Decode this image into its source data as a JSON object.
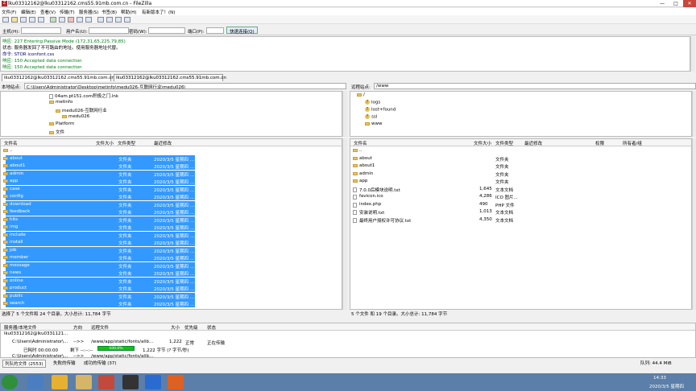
{
  "window": {
    "title": "lku03312162@lku03312162.cms55.91mb.com.cn - FileZilla",
    "minimize": "—",
    "maximize": "□",
    "close": "✕"
  },
  "menu": [
    "文件(F)",
    "编辑(E)",
    "查看(V)",
    "传输(T)",
    "服务器(S)",
    "书签(B)",
    "帮助(H)",
    "有新版本了！(N)"
  ],
  "quickconnect": {
    "host_label": "主机(H):",
    "user_label": "用户名(U):",
    "pass_label": "密码(W):",
    "port_label": "端口(P):",
    "button": "快速连接(Q)"
  },
  "log": [
    {
      "prefix": "响应:",
      "text": "227 Entering Passive Mode (172,31,65,225,79,85)",
      "color": "green"
    },
    {
      "prefix": "状态:",
      "text": "服务器发回了不可路由的地址。使用服务器地址代替。",
      "color": "black"
    },
    {
      "prefix": "命令:",
      "text": "STOR iconfont.css",
      "color": "navy"
    },
    {
      "prefix": "响应:",
      "text": "150 Accepted data connection",
      "color": "green"
    },
    {
      "prefix": "响应:",
      "text": "150 Accepted data connection",
      "color": "green"
    }
  ],
  "tabs": [
    "lku03312162@lku03312162.cms55.91mb.com.cn",
    "lku03312162@lku03312162.cms55.91mb.com.cn"
  ],
  "local": {
    "path_label": "本地站点:",
    "path": "C:\\Users\\Administrator\\Desktop\\metinfo\\medu026-互联网行业\\medu026\\",
    "tree": [
      {
        "label": "04am.pt151.com积极之门.lnk",
        "type": "file",
        "indent": 3
      },
      {
        "label": "metinfo",
        "type": "folder",
        "indent": 3
      },
      {
        "label": "medu026-互联网行业",
        "type": "folder",
        "indent": 4
      },
      {
        "label": "medu026",
        "type": "folder",
        "indent": 5
      },
      {
        "label": "Platform",
        "type": "folder",
        "indent": 3
      },
      {
        "label": "文件",
        "type": "folder",
        "indent": 3
      }
    ],
    "columns": [
      "文件名",
      "文件大小",
      "文件类型",
      "最近修改"
    ],
    "files": [
      {
        "name": "..",
        "type": "",
        "date": "",
        "sel": false
      },
      {
        "name": "about",
        "type": "文件夹",
        "date": "2020/3/5 星期四 ...",
        "sel": true
      },
      {
        "name": "about1",
        "type": "文件夹",
        "date": "2020/3/5 星期四 ...",
        "sel": true
      },
      {
        "name": "admin",
        "type": "文件夹",
        "date": "2020/3/5 星期四 ...",
        "sel": true
      },
      {
        "name": "app",
        "type": "文件夹",
        "date": "2020/3/5 星期四 ...",
        "sel": true
      },
      {
        "name": "case",
        "type": "文件夹",
        "date": "2020/3/5 星期四 ...",
        "sel": true
      },
      {
        "name": "config",
        "type": "文件夹",
        "date": "2020/3/5 星期四 ...",
        "sel": true
      },
      {
        "name": "download",
        "type": "文件夹",
        "date": "2020/3/5 星期四 ...",
        "sel": true
      },
      {
        "name": "feedback",
        "type": "文件夹",
        "date": "2020/3/5 星期四 ...",
        "sel": true
      },
      {
        "name": "hits",
        "type": "文件夹",
        "date": "2020/3/5 星期四 ...",
        "sel": true
      },
      {
        "name": "img",
        "type": "文件夹",
        "date": "2020/3/5 星期四 ...",
        "sel": true
      },
      {
        "name": "include",
        "type": "文件夹",
        "date": "2020/3/5 星期四 ...",
        "sel": true
      },
      {
        "name": "install",
        "type": "文件夹",
        "date": "2020/3/5 星期四 ...",
        "sel": true
      },
      {
        "name": "job",
        "type": "文件夹",
        "date": "2020/3/5 星期四 ...",
        "sel": true
      },
      {
        "name": "member",
        "type": "文件夹",
        "date": "2020/3/5 星期四 ...",
        "sel": true
      },
      {
        "name": "message",
        "type": "文件夹",
        "date": "2020/3/5 星期四 ...",
        "sel": true
      },
      {
        "name": "news",
        "type": "文件夹",
        "date": "2020/3/5 星期四 ...",
        "sel": true
      },
      {
        "name": "online",
        "type": "文件夹",
        "date": "2020/3/5 星期四 ...",
        "sel": true
      },
      {
        "name": "product",
        "type": "文件夹",
        "date": "2020/3/5 星期四 ...",
        "sel": true
      },
      {
        "name": "public",
        "type": "文件夹",
        "date": "2020/3/5 星期四 ...",
        "sel": true
      },
      {
        "name": "search",
        "type": "文件夹",
        "date": "2020/3/5 星期四 ...",
        "sel": true
      }
    ],
    "status": "选择了 5 个文件和 24 个目录。大小总计: 11,784 字节"
  },
  "remote": {
    "path_label": "远程站点:",
    "path": "/www",
    "tree": [
      {
        "label": "/",
        "type": "folder",
        "indent": 0
      },
      {
        "label": "logs",
        "type": "q",
        "indent": 1
      },
      {
        "label": "lost+found",
        "type": "q",
        "indent": 1
      },
      {
        "label": "ssl",
        "type": "q",
        "indent": 1
      },
      {
        "label": "www",
        "type": "folder",
        "indent": 1
      }
    ],
    "columns": [
      "文件名",
      "文件大小",
      "文件类型",
      "最近修改",
      "权限",
      "所有者/组"
    ],
    "files": [
      {
        "name": "..",
        "size": "",
        "type": "",
        "kind": "folder"
      },
      {
        "name": "about",
        "size": "",
        "type": "文件夹",
        "kind": "folder"
      },
      {
        "name": "about1",
        "size": "",
        "type": "文件夹",
        "kind": "folder"
      },
      {
        "name": "admin",
        "size": "",
        "type": "文件夹",
        "kind": "folder"
      },
      {
        "name": "app",
        "size": "",
        "type": "文件夹",
        "kind": "folder"
      },
      {
        "name": "7.0.0后模块说明.txt",
        "size": "1,645",
        "type": "文本文档",
        "kind": "file"
      },
      {
        "name": "favicon.ico",
        "size": "4,286",
        "type": "ICO 图片...",
        "kind": "file"
      },
      {
        "name": "index.php",
        "size": "490",
        "type": "PHP 文件",
        "kind": "file"
      },
      {
        "name": "安装说明.txt",
        "size": "1,013",
        "type": "文本文档",
        "kind": "file"
      },
      {
        "name": "最终用户授权许可协议.txt",
        "size": "4,350",
        "type": "文本文档",
        "kind": "file"
      }
    ],
    "status": "5 个文件 和 19 个目录。大小总计: 11,784 字节"
  },
  "queue": {
    "columns": [
      "服务器/本地文件",
      "方向",
      "远程文件",
      "大小",
      "优先级",
      "状态"
    ],
    "server": "lku03312162@lku0331121...",
    "rows": [
      {
        "local": "C:\\Users\\Administrator\\...",
        "dir": "-->>",
        "remote": "/www/app/static/fonts/alib...",
        "size": "1,222",
        "prio": "正常",
        "status": "正在传输"
      },
      {
        "local": "已耗时 00:00:00",
        "dir": "剩下 --:--:--",
        "remote": "100.0%",
        "size": "1,222 字节 (? 字节/秒)",
        "prio": "",
        "status": ""
      },
      {
        "local": "C:\\Users\\Administrator\\...",
        "dir": "-->>",
        "remote": "/www/app/static/fonts/alib...",
        "size": "1,222",
        "prio": "正常",
        "status": "正在传输"
      }
    ],
    "tabs": [
      "列队的文件 (2553)",
      "失败的传输",
      "成功的传输 (37)"
    ],
    "queue_label": "队列: 44.4 MiB"
  },
  "taskbar": {
    "time": "14:33",
    "date": "2020/3/5 星期四"
  }
}
